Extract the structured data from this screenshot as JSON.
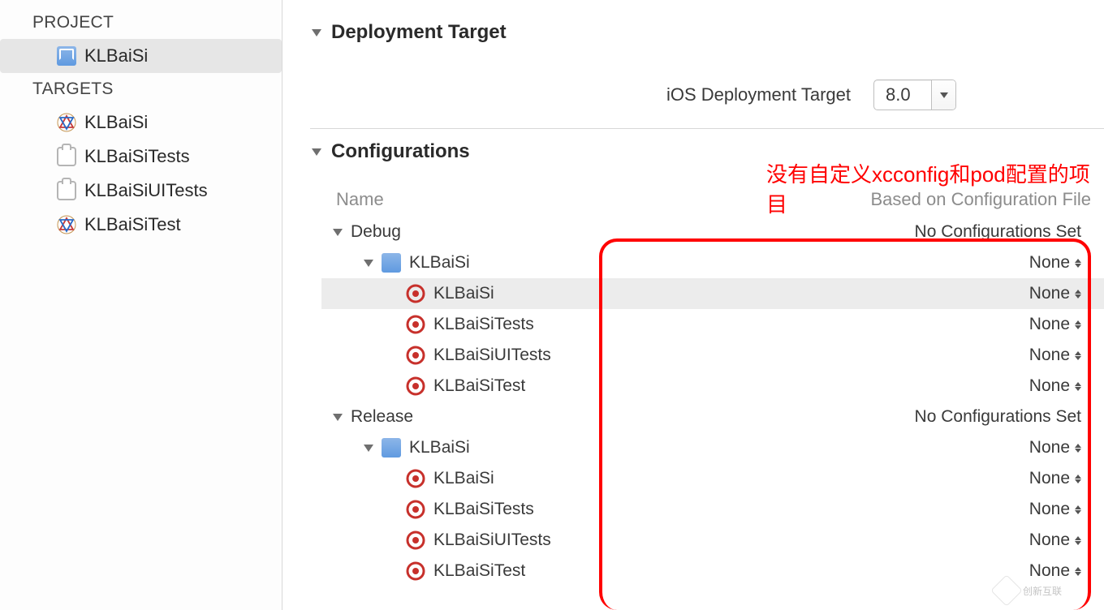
{
  "sidebar": {
    "project_header": "PROJECT",
    "targets_header": "TARGETS",
    "project_item": "KLBaiSi",
    "targets": [
      {
        "label": "KLBaiSi",
        "icon": "app"
      },
      {
        "label": "KLBaiSiTests",
        "icon": "test"
      },
      {
        "label": "KLBaiSiUITests",
        "icon": "test"
      },
      {
        "label": "KLBaiSiTest",
        "icon": "app"
      }
    ]
  },
  "deployment": {
    "section_title": "Deployment Target",
    "label": "iOS Deployment Target",
    "value": "8.0"
  },
  "configurations": {
    "section_title": "Configurations",
    "annotation": "没有自定义xcconfig和pod配置的项目",
    "column_name": "Name",
    "column_based": "Based on Configuration File",
    "none_label": "None",
    "groups": [
      {
        "name": "Debug",
        "status": "No Configurations Set",
        "project": "KLBaiSi",
        "project_value": "None",
        "targets": [
          {
            "name": "KLBaiSi",
            "value": "None",
            "highlighted": true
          },
          {
            "name": "KLBaiSiTests",
            "value": "None"
          },
          {
            "name": "KLBaiSiUITests",
            "value": "None"
          },
          {
            "name": "KLBaiSiTest",
            "value": "None"
          }
        ]
      },
      {
        "name": "Release",
        "status": "No Configurations Set",
        "project": "KLBaiSi",
        "project_value": "None",
        "targets": [
          {
            "name": "KLBaiSi",
            "value": "None"
          },
          {
            "name": "KLBaiSiTests",
            "value": "None"
          },
          {
            "name": "KLBaiSiUITests",
            "value": "None"
          },
          {
            "name": "KLBaiSiTest",
            "value": "None"
          }
        ]
      }
    ]
  },
  "watermark": "创新互联"
}
